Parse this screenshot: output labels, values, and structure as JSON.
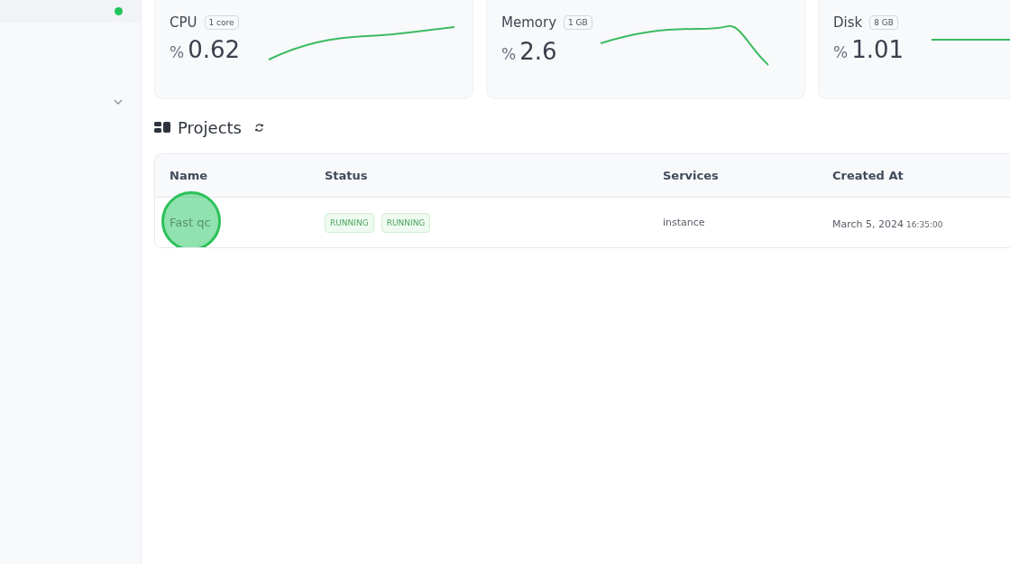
{
  "sidebar": {
    "status_active": true,
    "menu_expanded": false
  },
  "metrics": [
    {
      "label": "CPU",
      "badge": "1 core",
      "unit": "%",
      "value": "0.62"
    },
    {
      "label": "Memory",
      "badge": "1 GB",
      "unit": "%",
      "value": "2.6"
    },
    {
      "label": "Disk",
      "badge": "8 GB",
      "unit": "%",
      "value": "1.01"
    }
  ],
  "projects": {
    "title": "Projects",
    "table": {
      "columns": [
        "Name",
        "Status",
        "Services",
        "Created At"
      ],
      "rows": [
        {
          "name": "Fast qc",
          "statuses": [
            "RUNNING",
            "RUNNING"
          ],
          "services": "instance",
          "date": "March 5, 2024",
          "time": "16:35:00"
        }
      ]
    }
  }
}
